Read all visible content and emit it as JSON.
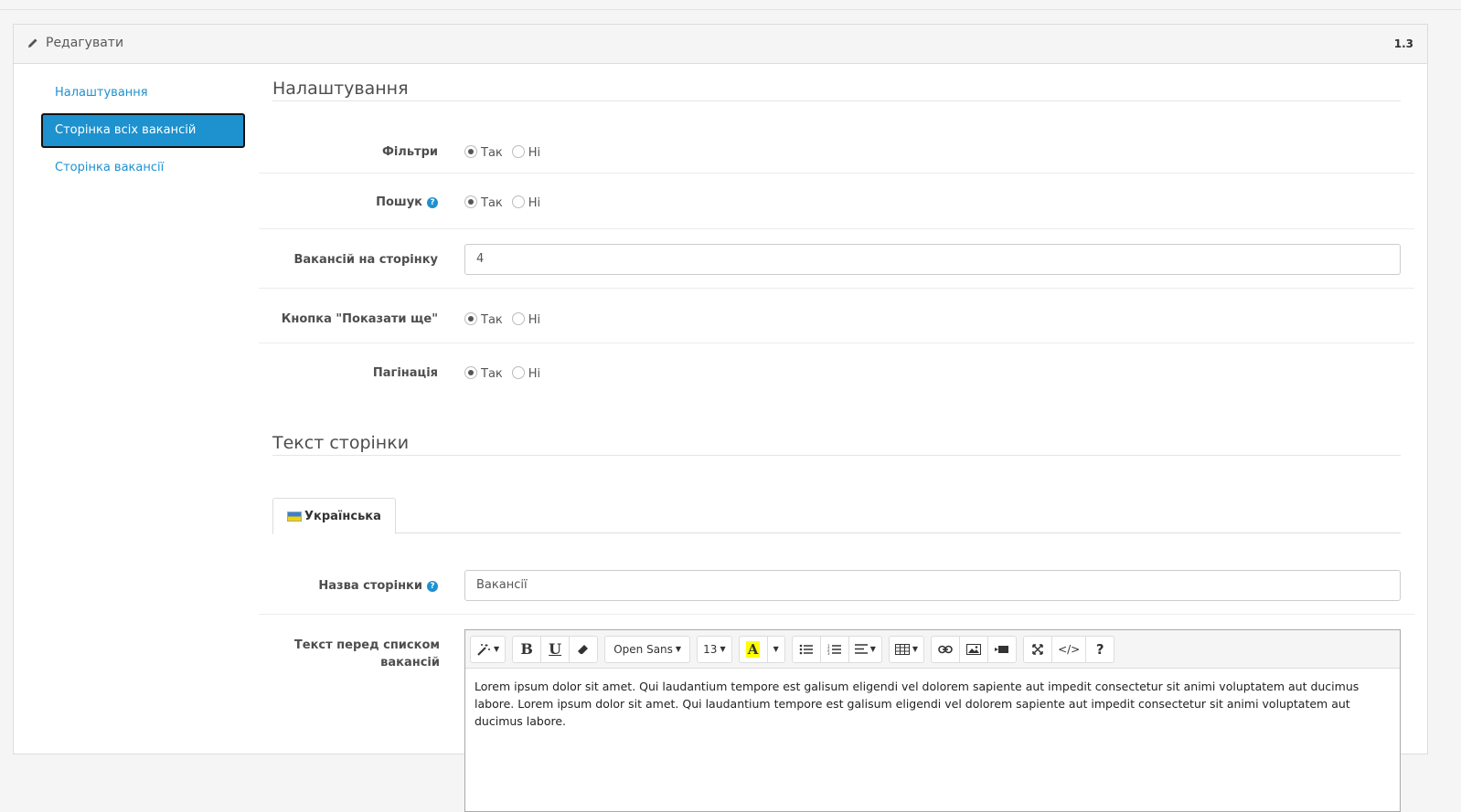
{
  "panel": {
    "title": "Редагувати",
    "version": "1.3"
  },
  "sidebar": {
    "items": [
      {
        "label": "Налаштування"
      },
      {
        "label": "Сторінка всіх вакансій"
      },
      {
        "label": "Сторінка вакансії"
      }
    ]
  },
  "settings": {
    "legend": "Налаштування",
    "filters": {
      "label": "Фільтри",
      "yes": "Так",
      "no": "Ні"
    },
    "search": {
      "label": "Пошук",
      "help": "?",
      "yes": "Так",
      "no": "Ні"
    },
    "per_page": {
      "label": "Вакансій на сторінку",
      "value": "4"
    },
    "show_more": {
      "label": "Кнопка \"Показати ще\"",
      "yes": "Так",
      "no": "Ні"
    },
    "pagination": {
      "label": "Пагінація",
      "yes": "Так",
      "no": "Ні"
    }
  },
  "page_text": {
    "legend": "Текст сторінки",
    "tab": "Українська",
    "page_name": {
      "label": "Назва сторінки",
      "help": "?",
      "value": "Вакансії"
    },
    "intro": {
      "label": "Текст перед списком вакансій",
      "font": "Open Sans",
      "size": "13",
      "content": "Lorem ipsum dolor sit amet. Qui laudantium tempore est galisum eligendi vel dolorem sapiente aut impedit consectetur sit animi voluptatem aut ducimus labore. Lorem ipsum dolor sit amet. Qui laudantium tempore est galisum eligendi vel dolorem sapiente aut impedit consectetur sit animi voluptatem aut ducimus labore."
    }
  },
  "toolbar_icons": {
    "bold": "B",
    "underline": "U",
    "highlight": "A",
    "codeview": "</>",
    "help": "?"
  },
  "colors": {
    "accent": "#1e91cf",
    "highlight": "#ffff00"
  }
}
